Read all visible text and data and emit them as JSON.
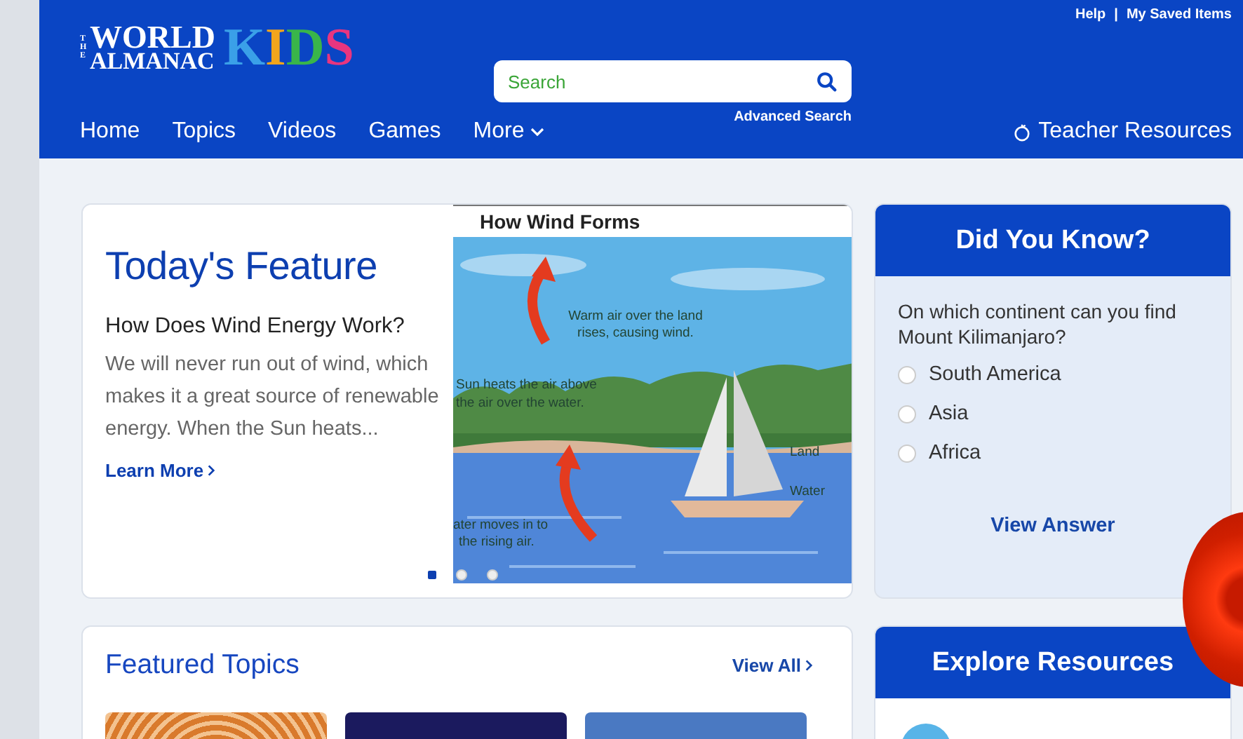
{
  "header": {
    "logo": {
      "top": "THE",
      "line1": "WORLD",
      "line2": "ALMANAC",
      "kids": "KIDS"
    },
    "search": {
      "placeholder": "Search",
      "advanced": "Advanced Search"
    },
    "top_links": [
      "Help",
      "|",
      "My Saved Items"
    ],
    "nav": [
      {
        "label": "Home",
        "kind": "link"
      },
      {
        "label": "Topics",
        "kind": "link"
      },
      {
        "label": "Videos",
        "kind": "link"
      },
      {
        "label": "Games",
        "kind": "link"
      },
      {
        "label": "More",
        "kind": "dropdown"
      }
    ],
    "teacher_link": "Teacher Resources"
  },
  "feature": {
    "heading": "Today's Feature",
    "title": "How Does Wind Energy Work?",
    "summary": "We will never run out of wind, which makes it a great source of renewable energy. When the Sun heats...",
    "link": "Learn More",
    "illustration": {
      "caption": "How Wind Forms",
      "labels": [
        "Warm air over the land",
        "rises, causing wind.",
        "Sun heats the air above",
        "the air over the water.",
        "Land",
        "Water",
        "ater moves in to",
        "the rising air."
      ]
    },
    "slides": [
      {
        "selected": true
      },
      {
        "selected": false
      },
      {
        "selected": false
      }
    ]
  },
  "did_you_know": {
    "title": "Did You Know?",
    "question": "On which continent can you find Mount Kilimanjaro?",
    "options": [
      {
        "label": "South America",
        "selected": false
      },
      {
        "label": "Asia",
        "selected": false
      },
      {
        "label": "Africa",
        "selected": false
      }
    ],
    "action": "View Answer"
  },
  "featured_topics": {
    "title": "Featured Topics",
    "link": "View All"
  },
  "explore": {
    "title": "Explore Resources"
  }
}
